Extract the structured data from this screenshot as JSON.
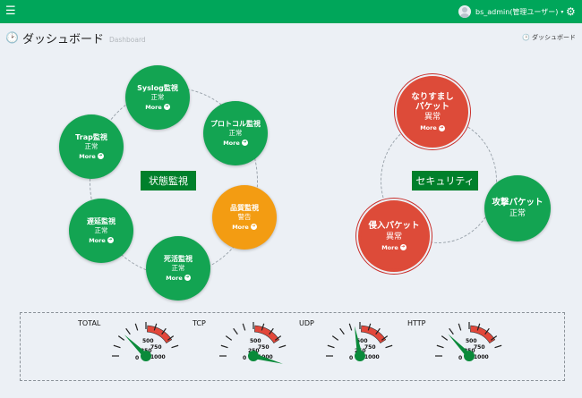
{
  "header": {
    "menu_icon": "☰",
    "user_name": "bs_admin(管理ユーザー)",
    "caret": "▾",
    "gears_icon": "⚙"
  },
  "page": {
    "dash_icon": "🕑",
    "title": "ダッシュボード",
    "subtitle": "Dashboard",
    "breadcrumb_icon": "🕑",
    "breadcrumb": "ダッシュボード"
  },
  "monitoring": {
    "center_label": "状態監視",
    "more_label": "More",
    "nodes": [
      {
        "title": "Syslog監視",
        "status": "正常",
        "color": "#13a452"
      },
      {
        "title": "プロトコル監視",
        "status": "正常",
        "color": "#13a452"
      },
      {
        "title": "品質監視",
        "status": "警告",
        "color": "#f39c12"
      },
      {
        "title": "死活監視",
        "status": "正常",
        "color": "#13a452"
      },
      {
        "title": "遅延監視",
        "status": "正常",
        "color": "#13a452"
      },
      {
        "title": "Trap監視",
        "status": "正常",
        "color": "#13a452"
      }
    ]
  },
  "security": {
    "center_label": "セキュリティ",
    "more_label": "More",
    "nodes": [
      {
        "title": "なりすまし\nパケット",
        "status": "異常",
        "color": "#dd4b39"
      },
      {
        "title": "攻撃パケット",
        "status": "正常",
        "color": "#13a452"
      },
      {
        "title": "侵入パケット",
        "status": "異常",
        "color": "#dd4b39"
      }
    ]
  },
  "gauges": {
    "items": [
      {
        "label": "TOTAL",
        "value": 60
      },
      {
        "label": "TCP",
        "value": 1000
      },
      {
        "label": "UDP",
        "value": 280
      },
      {
        "label": "HTTP",
        "value": 70
      }
    ],
    "tick_labels": [
      "0",
      "250",
      "500",
      "750",
      "1000"
    ],
    "max": 1000,
    "danger_from": 750
  }
}
